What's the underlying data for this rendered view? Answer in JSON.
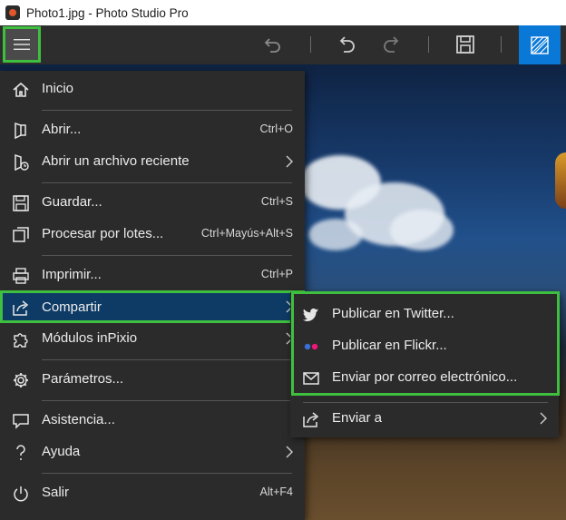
{
  "window": {
    "title": "Photo1.jpg - Photo Studio Pro"
  },
  "toolbar": {
    "icons": [
      "menu-icon",
      "undo-icon",
      "undo-icon",
      "redo-icon",
      "save-icon",
      "view-toggle-icon"
    ]
  },
  "menu": {
    "items": [
      {
        "label": "Inicio",
        "shortcut": ""
      },
      {
        "label": "Abrir...",
        "shortcut": "Ctrl+O"
      },
      {
        "label": "Abrir un archivo reciente",
        "shortcut": ""
      },
      {
        "label": "Guardar...",
        "shortcut": "Ctrl+S"
      },
      {
        "label": "Procesar por lotes...",
        "shortcut": "Ctrl+Mayús+Alt+S"
      },
      {
        "label": "Imprimir...",
        "shortcut": "Ctrl+P"
      },
      {
        "label": "Compartir",
        "shortcut": ""
      },
      {
        "label": "Módulos inPixio",
        "shortcut": ""
      },
      {
        "label": "Parámetros...",
        "shortcut": ""
      },
      {
        "label": "Asistencia...",
        "shortcut": ""
      },
      {
        "label": "Ayuda",
        "shortcut": ""
      },
      {
        "label": "Salir",
        "shortcut": "Alt+F4"
      }
    ]
  },
  "submenu": {
    "items": [
      {
        "label": "Publicar en Twitter..."
      },
      {
        "label": "Publicar en Flickr..."
      },
      {
        "label": "Enviar por correo electrónico..."
      },
      {
        "label": "Enviar a"
      }
    ]
  },
  "colors": {
    "accent": "#0a78d7",
    "highlight": "#3fbf3f",
    "active_item": "#0e3b66",
    "menu_bg": "#2b2b2b"
  }
}
